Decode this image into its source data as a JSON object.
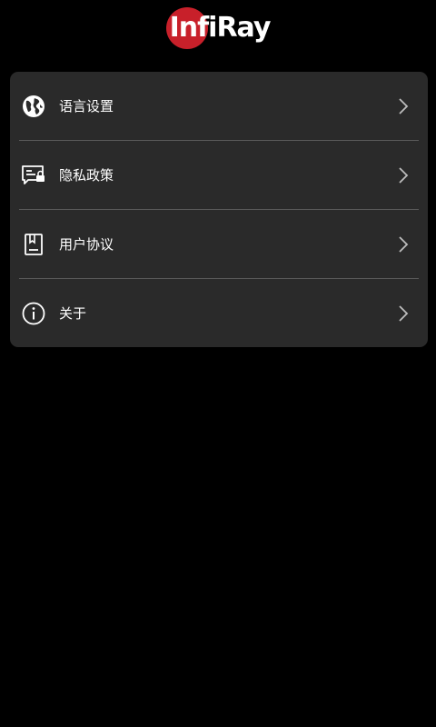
{
  "logo": {
    "text_part1": "Infi",
    "text_part2": "Ray",
    "brand_color": "#c8202a"
  },
  "menu": {
    "items": [
      {
        "label": "语言设置",
        "icon": "globe-icon"
      },
      {
        "label": "隐私政策",
        "icon": "privacy-message-icon"
      },
      {
        "label": "用户协议",
        "icon": "document-bookmark-icon"
      },
      {
        "label": "关于",
        "icon": "info-icon"
      }
    ],
    "chevron_icon": "chevron-right-icon"
  },
  "colors": {
    "background": "#000000",
    "panel": "#2a2a2a",
    "divider": "#5a5a5a",
    "text": "#ffffff",
    "chevron": "#bdbdbd"
  }
}
